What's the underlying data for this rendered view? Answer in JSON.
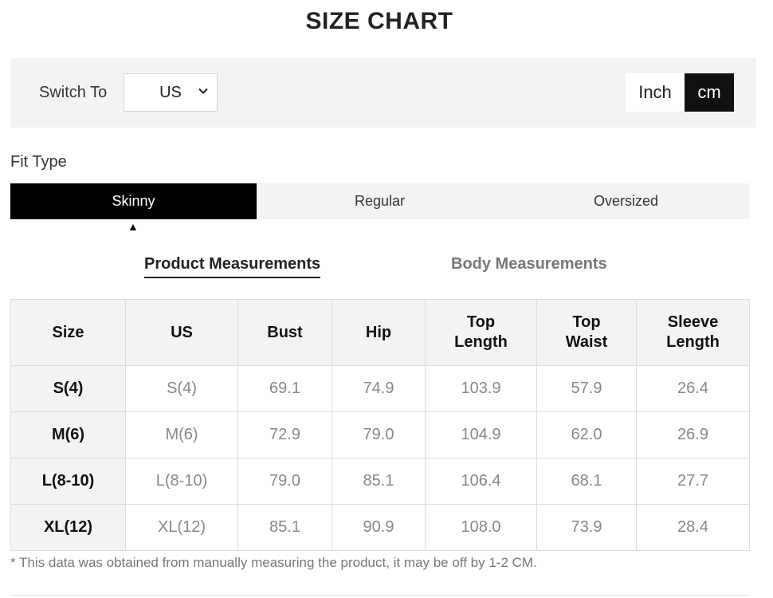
{
  "title": "SIZE CHART",
  "toolbar": {
    "switch_label": "Switch To",
    "region_value": "US",
    "units": [
      "Inch",
      "cm"
    ],
    "active_unit": "cm"
  },
  "fit": {
    "label": "Fit Type",
    "tabs": [
      "Skinny",
      "Regular",
      "Oversized"
    ],
    "active": "Skinny"
  },
  "measurement_tabs": {
    "product": "Product Measurements",
    "body": "Body Measurements",
    "active": "Product Measurements"
  },
  "table": {
    "headers": [
      "Size",
      "US",
      "Bust",
      "Hip",
      "Top\nLength",
      "Top\nWaist",
      "Sleeve\nLength"
    ],
    "rows": [
      [
        "S(4)",
        "S(4)",
        "69.1",
        "74.9",
        "103.9",
        "57.9",
        "26.4"
      ],
      [
        "M(6)",
        "M(6)",
        "72.9",
        "79.0",
        "104.9",
        "62.0",
        "26.9"
      ],
      [
        "L(8-10)",
        "L(8-10)",
        "79.0",
        "85.1",
        "106.4",
        "68.1",
        "27.7"
      ],
      [
        "XL(12)",
        "XL(12)",
        "85.1",
        "90.9",
        "108.0",
        "73.9",
        "28.4"
      ]
    ]
  },
  "note": "* This data was obtained from manually measuring the product, it may be off by 1-2 CM.",
  "colors": {
    "panel_bg": "#f3f3f3",
    "active_bg": "#000000",
    "muted_text": "#888888"
  }
}
